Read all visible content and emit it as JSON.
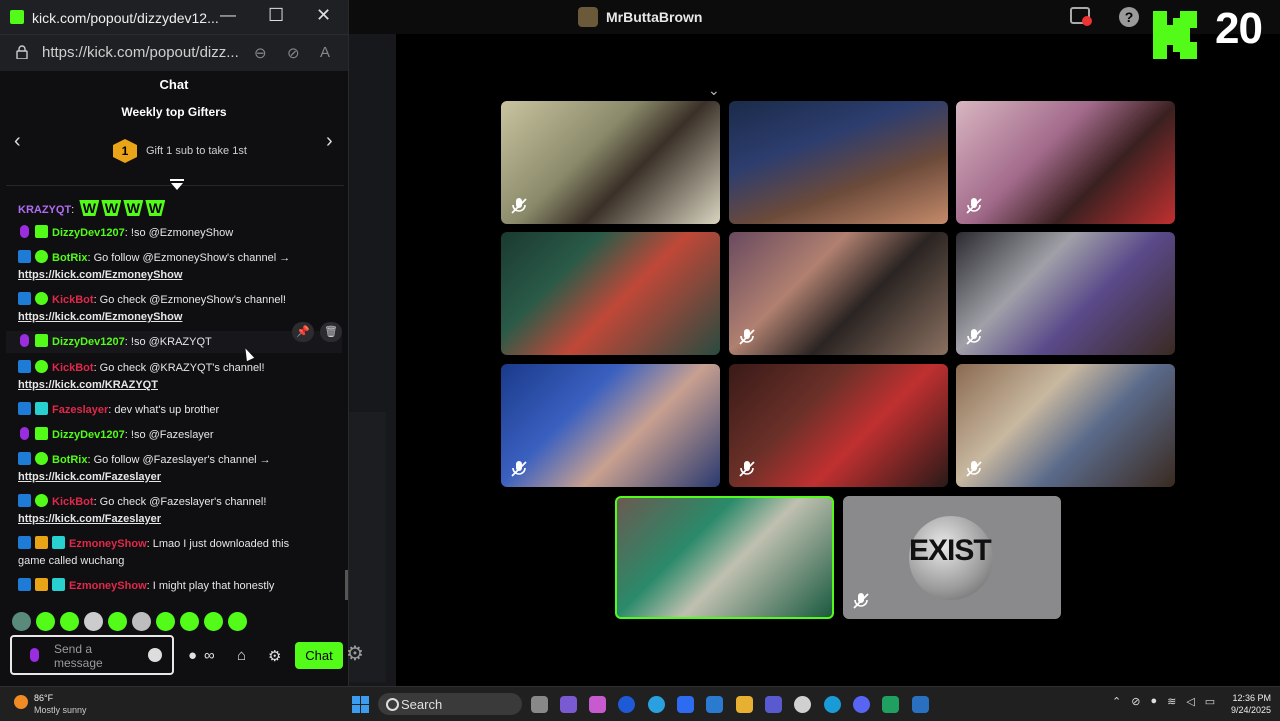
{
  "browser": {
    "window_title": "kick.com/popout/dizzydev12...",
    "url": "https://kick.com/popout/dizz..."
  },
  "call": {
    "host_name": "MrButtaBrown",
    "logo_number": "20"
  },
  "chat": {
    "header": "Chat",
    "gifters": {
      "title": "Weekly top Gifters",
      "rank": "1",
      "hint": "Gift 1 sub to take 1st"
    },
    "emotes_first_line": "W W W W",
    "messages": [
      {
        "user": "KRAZYQT",
        "user_color": "#b06cf0",
        "text": ""
      },
      {
        "user": "DizzyDev1207",
        "user_color": "#53fc18",
        "text": ": !so @EzmoneyShow"
      },
      {
        "user": "BotRix",
        "user_color": "#53fc18",
        "text": ": Go follow @EzmoneyShow's channel →",
        "link": "https://kick.com/EzmoneyShow"
      },
      {
        "user": "KickBot",
        "user_color": "#e0284a",
        "text": ": Go check @EzmoneyShow's channel!",
        "link": "https://kick.com/EzmoneyShow"
      },
      {
        "user": "DizzyDev1207",
        "user_color": "#53fc18",
        "text": ": !so @KRAZYQT"
      },
      {
        "user": "KickBot",
        "user_color": "#e0284a",
        "text": ": Go check @KRAZYQT's channel!",
        "link": "https://kick.com/KRAZYQT"
      },
      {
        "user": "Fazeslayer",
        "user_color": "#e0284a",
        "text": ": dev what's up brother"
      },
      {
        "user": "DizzyDev1207",
        "user_color": "#53fc18",
        "text": ": !so @Fazeslayer"
      },
      {
        "user": "BotRix",
        "user_color": "#53fc18",
        "text": ": Go follow @Fazeslayer's channel →",
        "link": "https://kick.com/Fazeslayer"
      },
      {
        "user": "KickBot",
        "user_color": "#e0284a",
        "text": ": Go check @Fazeslayer's channel!",
        "link": "https://kick.com/Fazeslayer"
      },
      {
        "user": "EzmoneyShow",
        "user_color": "#e0284a",
        "text": ": Lmao I just downloaded this",
        "cont": "game called wuchang"
      },
      {
        "user": "EzmoneyShow",
        "user_color": "#e0284a",
        "text": ": I might play that honestly"
      }
    ],
    "input_placeholder": "Send a message",
    "send_label": "Chat"
  },
  "tiles": {
    "exist_text": "EXIST"
  },
  "taskbar": {
    "temp": "86°F",
    "weather": "Mostly sunny",
    "search_label": "Search",
    "time": "12:36 PM",
    "date": "9/24/2025"
  },
  "colors": {
    "kick_green": "#53fc18",
    "active_speaker_border": "#53fc18"
  }
}
